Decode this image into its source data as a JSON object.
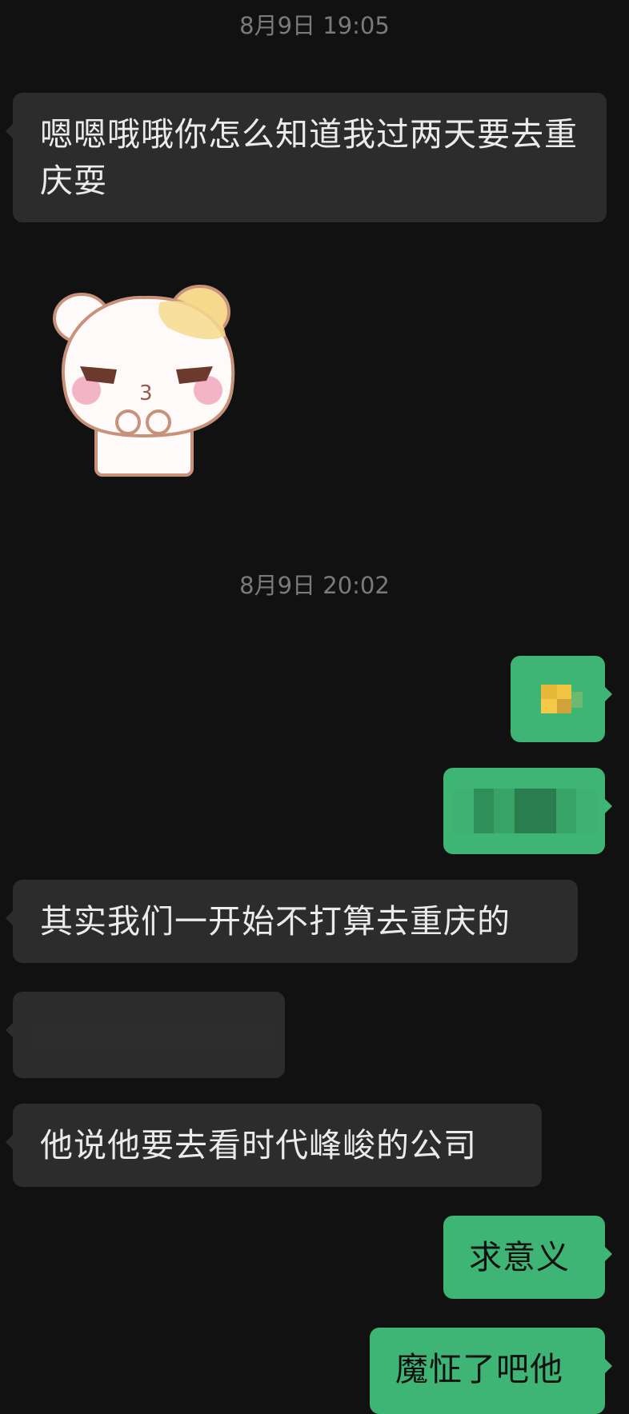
{
  "chat": {
    "timestamps": [
      "8月9日 19:05",
      "8月9日 20:02"
    ],
    "messages": {
      "m1": "嗯嗯哦哦你怎么知道我过两天要去重庆耍",
      "m5": "其实我们一开始不打算去重庆的",
      "m7": "他说他要去看时代峰峻的公司",
      "m8": "求意义",
      "m9": "魔怔了吧他"
    },
    "sticker": {
      "icon": "hamster-sticker-icon",
      "colors": {
        "body": "#fffafa",
        "outline": "#c8927a",
        "patch": "#f6d98c",
        "blush": "#f2b4c6",
        "eyes": "#6b3a2c"
      }
    },
    "redacted": {
      "sent_image_mosaic": [
        "#3eb575",
        "#e8b83a",
        "#f0c541",
        "#6cba6f"
      ],
      "sent_text_mosaic": [
        "#2e8f58",
        "#37a466",
        "#2a7d4f",
        "#3fb273"
      ]
    }
  },
  "theme": {
    "background": "#111111",
    "incoming_bubble": "#2c2c2c",
    "outgoing_bubble": "#3eb575",
    "timestamp_text": "#7a7a7a",
    "incoming_text": "#ebebeb",
    "outgoing_text": "#111111"
  }
}
